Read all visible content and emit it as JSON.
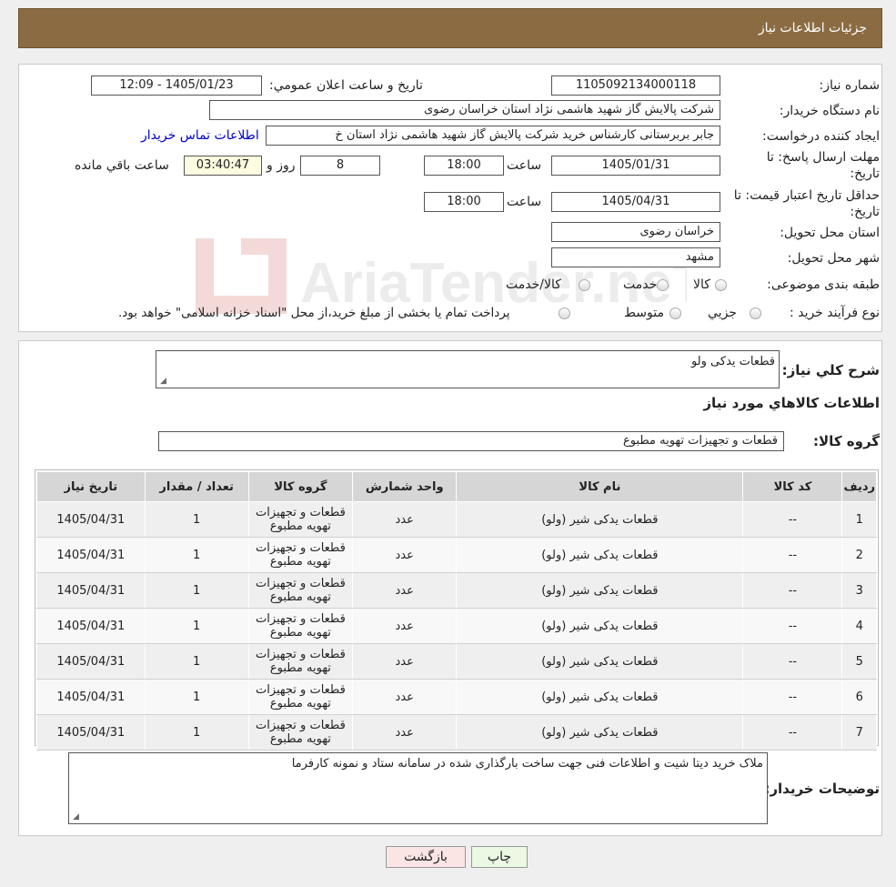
{
  "header": {
    "title": "جزئیات اطلاعات نیاز"
  },
  "fields": {
    "need_number_label": "شماره نیاز:",
    "need_number": "1105092134000118",
    "announce_label": "تاریخ و ساعت اعلان عمومي:",
    "announce_value": "1405/01/23 - 12:09",
    "buyer_org_label": "نام دستگاه خریدار:",
    "buyer_org": "شرکت پالايش گاز شهيد هاشمی نژاد   استان خراسان رضوی",
    "requester_label": "ایجاد کننده درخواست:",
    "requester": "جابر بربرستانی کارشناس خرید شرکت پالایش گاز شهید هاشمی نژاد   استان خ",
    "contact_link": "اطلاعات تماس خریدار",
    "deadline_label_1": "مهلت ارسال پاسخ: تا",
    "deadline_label_2": "تاریخ:",
    "deadline_date": "1405/01/31",
    "time_label": "ساعت",
    "deadline_time": "18:00",
    "days_value": "8",
    "days_label": "روز و",
    "remaining_time": "03:40:47",
    "remaining_label": "ساعت باقي مانده",
    "validity_label_1": "حداقل تاریخ اعتبار قیمت: تا",
    "validity_label_2": "تاریخ:",
    "validity_date": "1405/04/31",
    "validity_time": "18:00",
    "province_label": "استان محل تحویل:",
    "province": "خراسان رضوی",
    "city_label": "شهر محل تحویل:",
    "city": "مشهد",
    "category_label": "طبقه بندی موضوعی:",
    "category_options": [
      "کالا",
      "خدمت",
      "کالا/خدمت"
    ],
    "process_label": "نوع فرآیند خرید :",
    "process_options": [
      "جزيي",
      "متوسط"
    ],
    "process_note": "پرداخت تمام یا بخشی از مبلغ خرید،از محل \"اسناد خزانه اسلامی\" خواهد بود."
  },
  "summary": {
    "label": "شرح كلي نياز:",
    "value": "قطعات یدکی ولو",
    "goods_info_title": "اطلاعات كالاهاي مورد نياز",
    "group_label": "گروه كالا:",
    "group_value": "قطعات و تجهیزات تهویه مطبوع"
  },
  "table": {
    "headers": [
      "رديف",
      "کد کالا",
      "نام کالا",
      "واحد شمارش",
      "گروه کالا",
      "تعداد / مقدار",
      "تاریخ نیاز"
    ],
    "rows": [
      [
        "1",
        "--",
        "قطعات یدکی شیر (ولو)",
        "عدد",
        "قطعات و تجهیزات تهویه مطبوع",
        "1",
        "1405/04/31"
      ],
      [
        "2",
        "--",
        "قطعات یدکی شیر (ولو)",
        "عدد",
        "قطعات و تجهیزات تهویه مطبوع",
        "1",
        "1405/04/31"
      ],
      [
        "3",
        "--",
        "قطعات یدکی شیر (ولو)",
        "عدد",
        "قطعات و تجهیزات تهویه مطبوع",
        "1",
        "1405/04/31"
      ],
      [
        "4",
        "--",
        "قطعات یدکی شیر (ولو)",
        "عدد",
        "قطعات و تجهیزات تهویه مطبوع",
        "1",
        "1405/04/31"
      ],
      [
        "5",
        "--",
        "قطعات یدکی شیر (ولو)",
        "عدد",
        "قطعات و تجهیزات تهویه مطبوع",
        "1",
        "1405/04/31"
      ],
      [
        "6",
        "--",
        "قطعات یدکی شیر (ولو)",
        "عدد",
        "قطعات و تجهیزات تهویه مطبوع",
        "1",
        "1405/04/31"
      ],
      [
        "7",
        "--",
        "قطعات یدکی شیر (ولو)",
        "عدد",
        "قطعات و تجهیزات تهویه مطبوع",
        "1",
        "1405/04/31"
      ]
    ]
  },
  "buyer_notes": {
    "label": "توضیحات خریدار:",
    "value": "ملاک خرید دیتا شیت و اطلاعات فنی جهت ساخت بارگذاری شده در سامانه ستاد و نمونه کارفرما"
  },
  "buttons": {
    "print": "چاپ",
    "back": "بازگشت"
  },
  "watermark": {
    "text": "AriaTender.neT"
  }
}
